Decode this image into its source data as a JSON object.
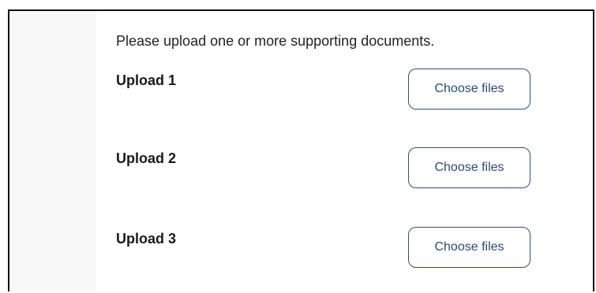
{
  "form": {
    "instruction": "Please upload one or more supporting documents.",
    "uploads": [
      {
        "label": "Upload 1",
        "button_label": "Choose files"
      },
      {
        "label": "Upload 2",
        "button_label": "Choose files"
      },
      {
        "label": "Upload 3",
        "button_label": "Choose files"
      }
    ]
  },
  "colors": {
    "button_border": "#2f4f7a",
    "button_text": "#2c4a73",
    "frame_border": "#111111"
  }
}
